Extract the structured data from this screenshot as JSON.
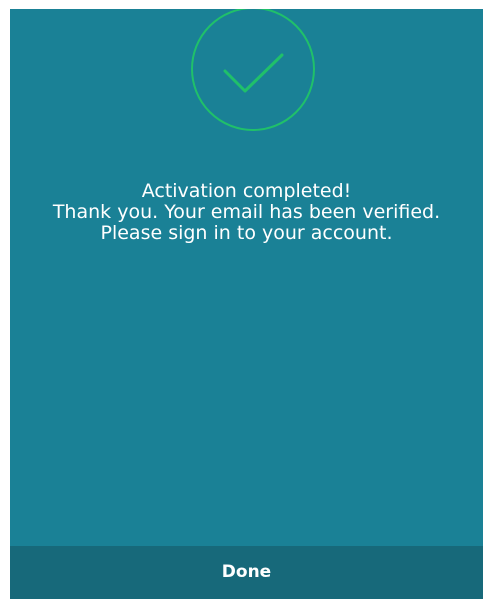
{
  "status_icon": {
    "name": "checkmark-circle-icon",
    "color": "#20c06a"
  },
  "message": {
    "line1": "Activation completed!",
    "line2": "Thank you. Your email has been verified.",
    "line3": "Please sign in to your account."
  },
  "footer": {
    "done_label": "Done"
  },
  "colors": {
    "panel_background": "#1a8196",
    "footer_background": "#17697a",
    "text": "#ffffff",
    "accent_green": "#20c06a"
  }
}
